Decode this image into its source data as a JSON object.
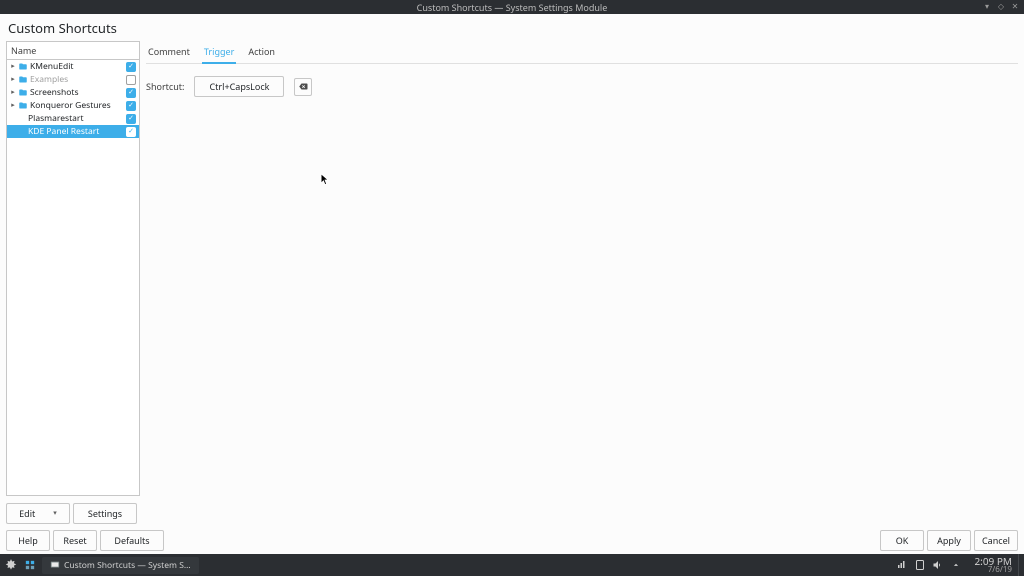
{
  "titlebar": {
    "title": "Custom Shortcuts — System Settings Module"
  },
  "header": "Custom Shortcuts",
  "tree": {
    "column": "Name",
    "items": [
      {
        "label": "KMenuEdit",
        "folder": true,
        "checked": true,
        "expandable": true
      },
      {
        "label": "Examples",
        "folder": true,
        "checked": false,
        "expandable": true,
        "disabled": true
      },
      {
        "label": "Screenshots",
        "folder": true,
        "checked": true,
        "expandable": true
      },
      {
        "label": "Konqueror Gestures",
        "folder": true,
        "checked": true,
        "expandable": true
      },
      {
        "label": "Plasmarestart",
        "folder": false,
        "checked": true,
        "expandable": false
      },
      {
        "label": "KDE Panel Restart",
        "folder": false,
        "checked": true,
        "expandable": false,
        "selected": true
      }
    ]
  },
  "tabs": {
    "items": [
      "Comment",
      "Trigger",
      "Action"
    ],
    "active": 1
  },
  "trigger": {
    "label": "Shortcut:",
    "value": "Ctrl+CapsLock"
  },
  "buttons": {
    "edit": "Edit",
    "settings": "Settings",
    "help": "Help",
    "reset": "Reset",
    "defaults": "Defaults",
    "ok": "OK",
    "apply": "Apply",
    "cancel": "Cancel"
  },
  "taskbar": {
    "task": "Custom Shortcuts — System S…",
    "time": "2:09 PM",
    "date": "7/6/19"
  }
}
